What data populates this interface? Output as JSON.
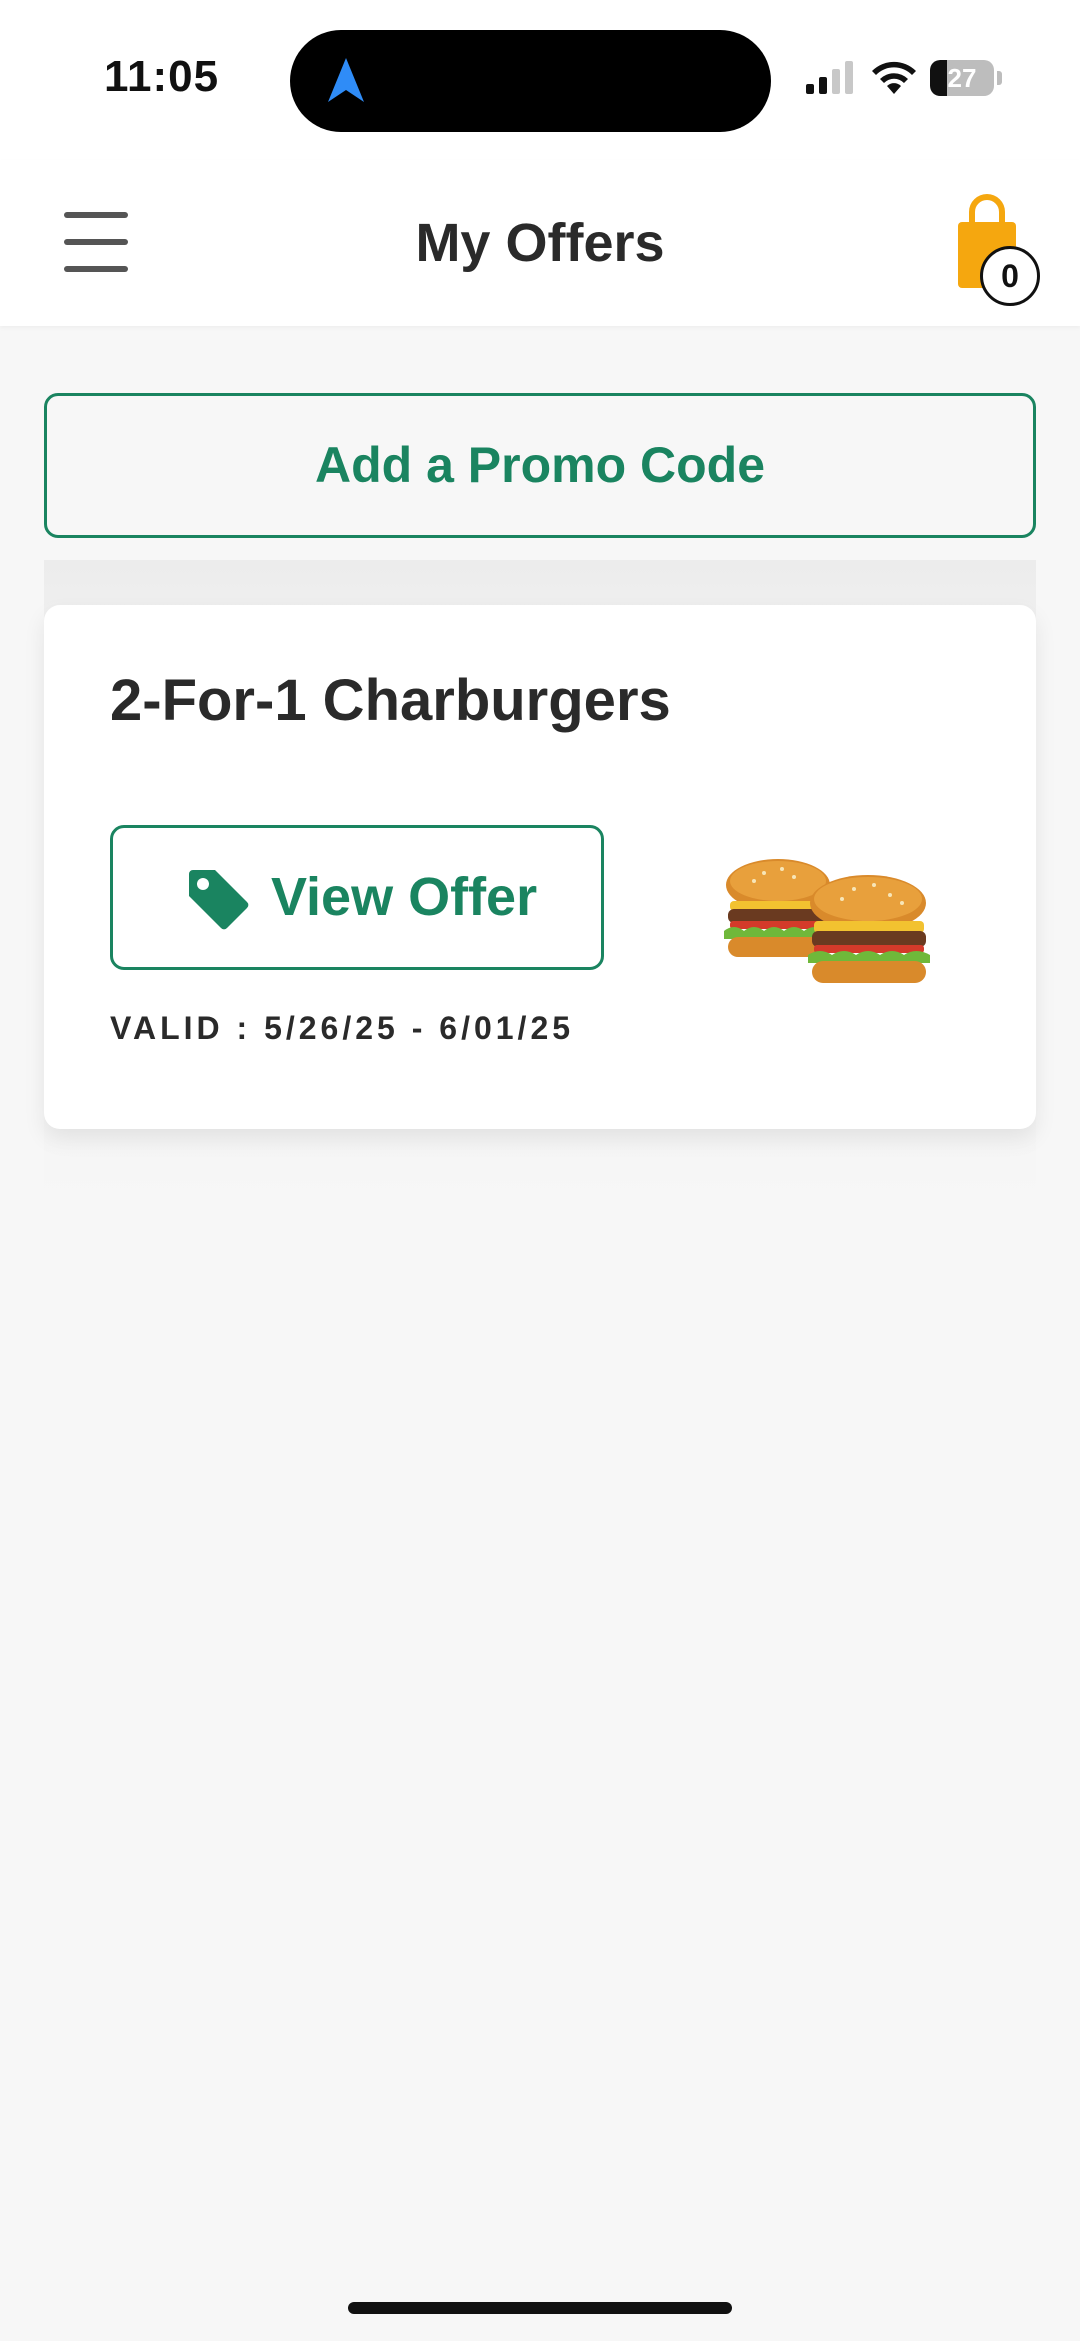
{
  "status_bar": {
    "time": "11:05",
    "battery": "27",
    "battery_level": 0.27,
    "icons": [
      "navigation-arrow-icon",
      "cellular-signal-icon",
      "wifi-icon",
      "battery-icon"
    ]
  },
  "header": {
    "title": "My Offers",
    "menu_icon": "hamburger-menu-icon",
    "cart_icon": "shopping-bag-icon",
    "cart_count": "0"
  },
  "promo": {
    "label": "Add a Promo Code"
  },
  "offers": [
    {
      "title": "2-For-1 Charburgers",
      "button_label": "View Offer",
      "button_icon": "price-tag-icon",
      "validity": "VALID : 5/26/25 - 6/01/25",
      "image": "two-charburgers-image"
    }
  ],
  "colors": {
    "accent_green": "#1a8460",
    "cart_orange": "#f5a70f",
    "text_dark": "#2a2a2a",
    "background": "#f7f7f7"
  }
}
